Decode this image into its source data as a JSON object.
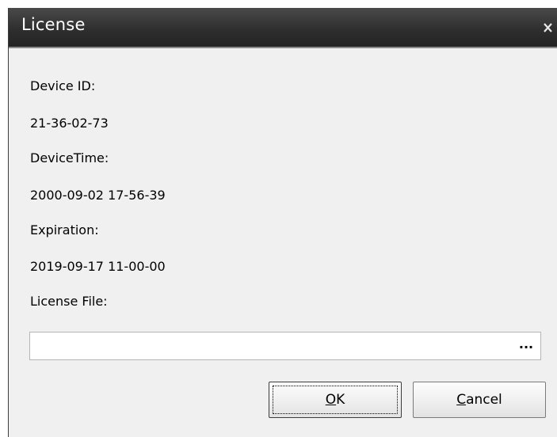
{
  "window": {
    "title": "License",
    "close_glyph": "x"
  },
  "fields": {
    "device_id_label": "Device ID:",
    "device_id_value": "21-36-02-73",
    "device_time_label": "DeviceTime:",
    "device_time_value": "2000-09-02 17-56-39",
    "expiration_label": "Expiration:",
    "expiration_value": "2019-09-17 11-00-00",
    "license_file_label": "License File:",
    "license_file_value": "",
    "browse_label": "..."
  },
  "buttons": {
    "ok_mnemonic": "O",
    "ok_rest": "K",
    "cancel_mnemonic": "C",
    "cancel_rest": "ancel"
  },
  "colors": {
    "titlebar": "#2f2f2f",
    "title_text": "#ffffff",
    "dialog_background": "#f0f0f0"
  },
  "icons": {
    "close": "close-icon",
    "browse": "ellipsis-icon"
  }
}
